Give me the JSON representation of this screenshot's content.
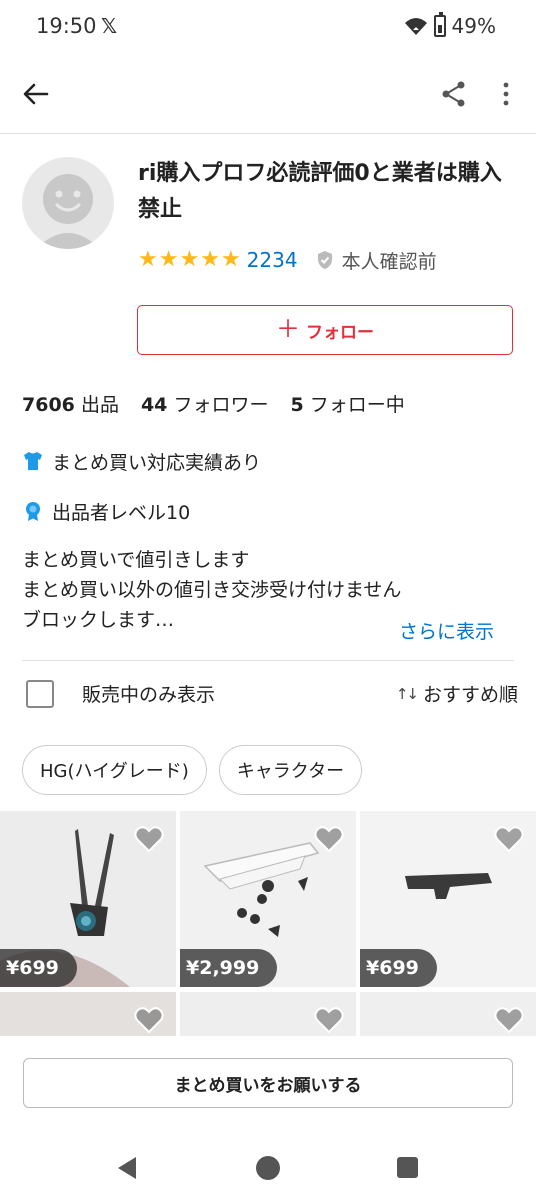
{
  "status_bar": {
    "time": "19:50",
    "x_logo": "𝕏",
    "battery": "49%"
  },
  "app_bar": {
    "icons": [
      "back-arrow-icon",
      "share-icon",
      "more-vert-icon"
    ]
  },
  "profile": {
    "name": "ri購入プロフ必読評価0と業者は購入禁止",
    "stars": [
      "★",
      "★",
      "★",
      "★",
      "★"
    ],
    "rating_count": "2234",
    "verification": "本人確認前",
    "follow_label": "フォロー",
    "follow_plus": "＋"
  },
  "stats": {
    "listings_count": "7606",
    "listings_label": "出品",
    "followers_count": "44",
    "followers_label": "フォロワー",
    "following_count": "5",
    "following_label": "フォロー中"
  },
  "badges": [
    {
      "label": "まとめ買い対応実績あり",
      "icon": "shirt-icon",
      "color": "#1e9be8"
    },
    {
      "label": "出品者レベル10",
      "icon": "medal-icon",
      "color": "#1e9be8"
    }
  ],
  "bio": {
    "lines": [
      "まとめ買いで値引きします",
      "まとめ買い以外の値引き交渉受け付けません",
      "ブロックします…"
    ],
    "more": "さらに表示"
  },
  "filter": {
    "on_sale_only": "販売中のみ表示",
    "checked": false,
    "sort_label": "おすすめ順",
    "sort_icon": "↑↓"
  },
  "chips": [
    "HG(ハイグレード)",
    "キャラクター"
  ],
  "items": [
    {
      "price": "¥699"
    },
    {
      "price": "¥2,999"
    },
    {
      "price": "¥699"
    },
    {
      "price": ""
    },
    {
      "price": ""
    },
    {
      "price": ""
    }
  ],
  "bulk_buy": {
    "label": "まとめ買いをお願いする"
  },
  "colors": {
    "accent_red": "#e0303c",
    "link_blue": "#0073cc",
    "star_yellow": "#ffb818"
  }
}
